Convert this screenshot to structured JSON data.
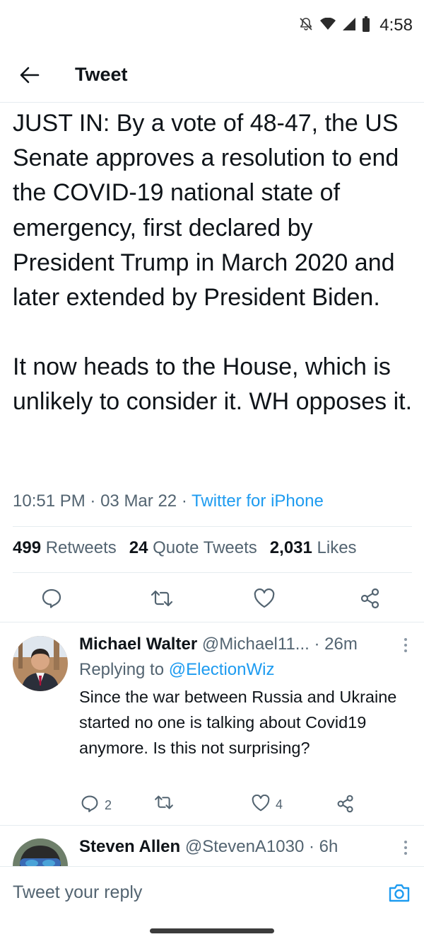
{
  "status_bar": {
    "time": "4:58"
  },
  "header": {
    "title": "Tweet"
  },
  "tweet": {
    "paragraphs": [
      "JUST IN: By a vote of 48-47, the US Senate approves a resolution to end the COVID-19 national state of emergency, first declared by President Trump in March 2020 and later extended by President Biden.",
      "It now heads to the House, which is unlikely to consider it. WH opposes it."
    ],
    "time": "10:51 PM",
    "date": "03 Mar 22",
    "source": "Twitter for iPhone",
    "separator": "·",
    "stats": {
      "retweets_count": "499",
      "retweets_label": "Retweets",
      "quotes_count": "24",
      "quotes_label": "Quote Tweets",
      "likes_count": "2,031",
      "likes_label": "Likes"
    }
  },
  "replies": [
    {
      "name": "Michael Walter",
      "handle": "@Michael11...",
      "time": "· 26m",
      "replying_prefix": "Replying to",
      "replying_handle": "@ElectionWiz",
      "text": "Since the war between Russia and Ukraine started no one is talking about Covid19 anymore. Is this not surprising?",
      "reply_count": "2",
      "like_count": "4"
    },
    {
      "name": "Steven Allen",
      "handle": "@StevenA1030",
      "time": "· 6h"
    }
  ],
  "compose": {
    "placeholder": "Tweet your reply"
  },
  "colors": {
    "accent": "#1d9bf0",
    "text": "#0f1419",
    "muted": "#536471",
    "divider": "#e6ecf0"
  }
}
